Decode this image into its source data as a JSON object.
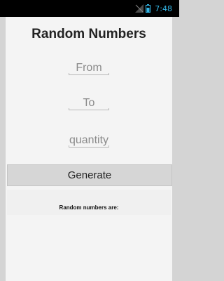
{
  "status_bar": {
    "time": "7:48",
    "accent_color": "#33b5e5",
    "icons": [
      "signal-icon",
      "battery-icon"
    ]
  },
  "app": {
    "title": "Random Numbers"
  },
  "form": {
    "from_placeholder": "From",
    "from_value": "",
    "to_placeholder": "To",
    "to_value": "",
    "quantity_placeholder": "quantity",
    "quantity_value": ""
  },
  "actions": {
    "generate_label": "Generate"
  },
  "result": {
    "label": "Random numbers are:",
    "numbers": ""
  }
}
